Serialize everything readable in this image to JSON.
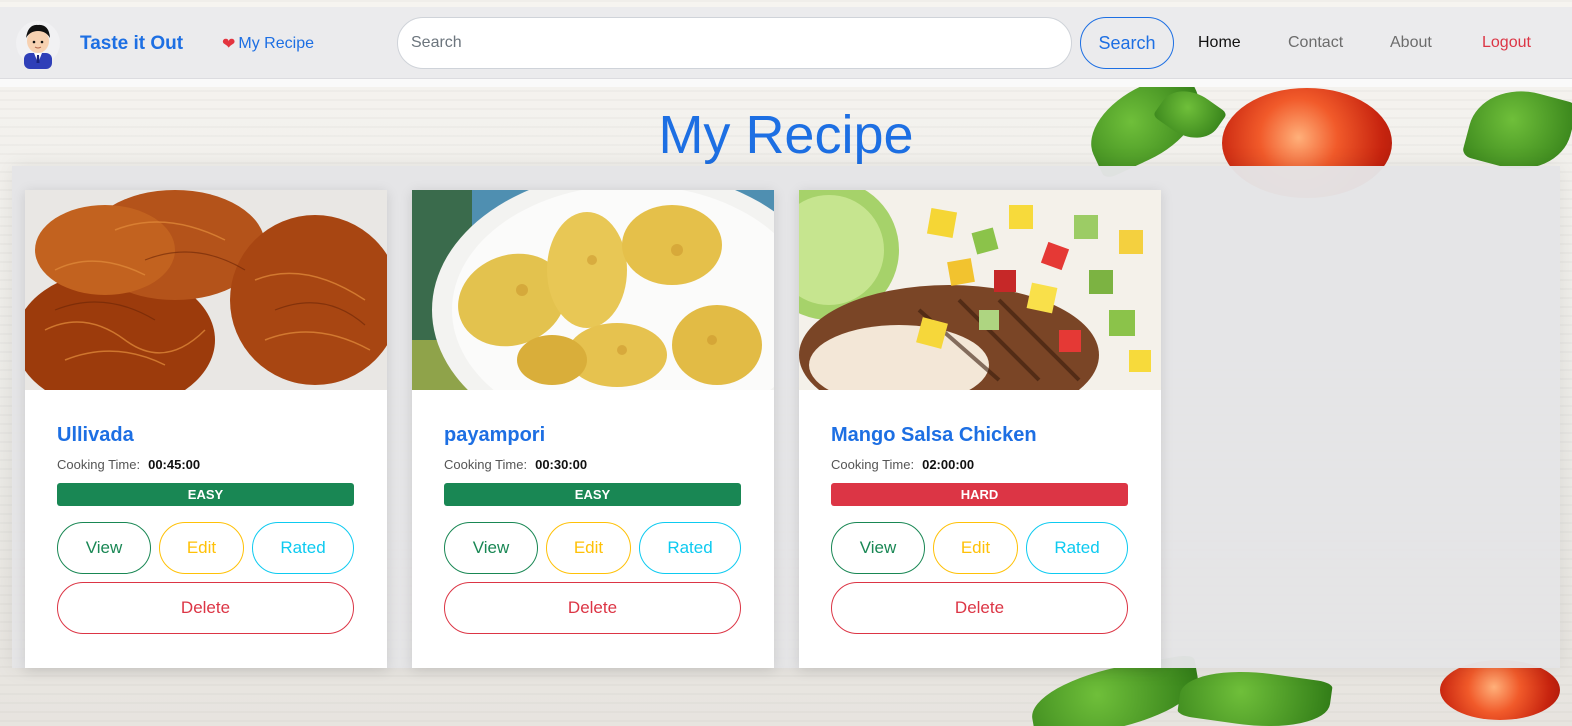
{
  "navbar": {
    "brand": "Taste it Out",
    "my_recipe_link": "My Recipe",
    "search_placeholder": "Search",
    "search_button": "Search",
    "links": [
      "Home",
      "Contact",
      "About",
      "Logout"
    ]
  },
  "page_title": "My Recipe",
  "cards": [
    {
      "title": "Ullivada",
      "time_label": "Cooking Time:",
      "time": "00:45:00",
      "difficulty": "EASY",
      "difficulty_color": "#198754",
      "buttons": {
        "view": "View",
        "edit": "Edit",
        "rated": "Rated",
        "delete": "Delete"
      }
    },
    {
      "title": "payampori",
      "time_label": "Cooking Time:",
      "time": "00:30:00",
      "difficulty": "EASY",
      "difficulty_color": "#198754",
      "buttons": {
        "view": "View",
        "edit": "Edit",
        "rated": "Rated",
        "delete": "Delete"
      }
    },
    {
      "title": "Mango Salsa Chicken",
      "time_label": "Cooking Time:",
      "time": "02:00:00",
      "difficulty": "HARD",
      "difficulty_color": "#dc3545",
      "buttons": {
        "view": "View",
        "edit": "Edit",
        "rated": "Rated",
        "delete": "Delete"
      }
    }
  ],
  "colors": {
    "primary": "#1d6fe3",
    "success": "#198754",
    "warning": "#ffc107",
    "info": "#0dcaf0",
    "danger": "#dc3545"
  }
}
